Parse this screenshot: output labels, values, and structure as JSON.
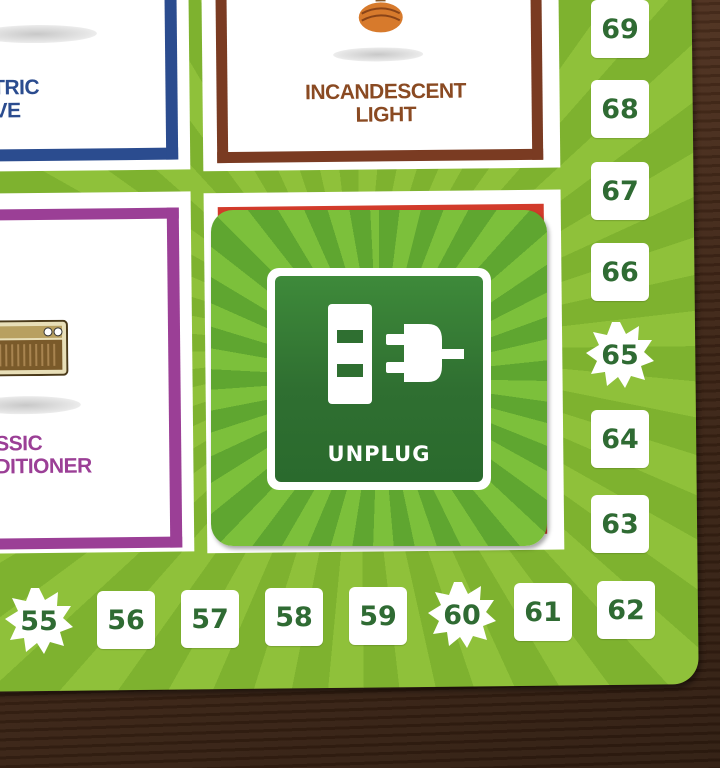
{
  "board": {
    "cells": [
      {
        "id": "electric-stove",
        "label_line1": "CTRIC",
        "label_line2": "OVE",
        "border_color": "#2b4c8f"
      },
      {
        "id": "incandescent-light",
        "label_line1": "INCANDESCENT",
        "label_line2": "LIGHT",
        "border_color": "#7a3b22"
      },
      {
        "id": "classic-air-conditioner",
        "label_line1": "SSIC",
        "label_line2": "DITIONER",
        "border_color": "#9b3f96"
      }
    ],
    "track_right": [
      "69",
      "68",
      "67",
      "66",
      "65",
      "64",
      "63"
    ],
    "track_bottom": [
      "55",
      "56",
      "57",
      "58",
      "59",
      "60",
      "61",
      "62"
    ],
    "star_spaces": [
      "55",
      "60",
      "65"
    ],
    "colors": {
      "number_text": "#2f6b33",
      "board_green": "#8fc13a",
      "tile_red_under": "#d23b2b"
    }
  },
  "tile": {
    "label": "UNPLUG",
    "icon": "unplug-icon"
  }
}
